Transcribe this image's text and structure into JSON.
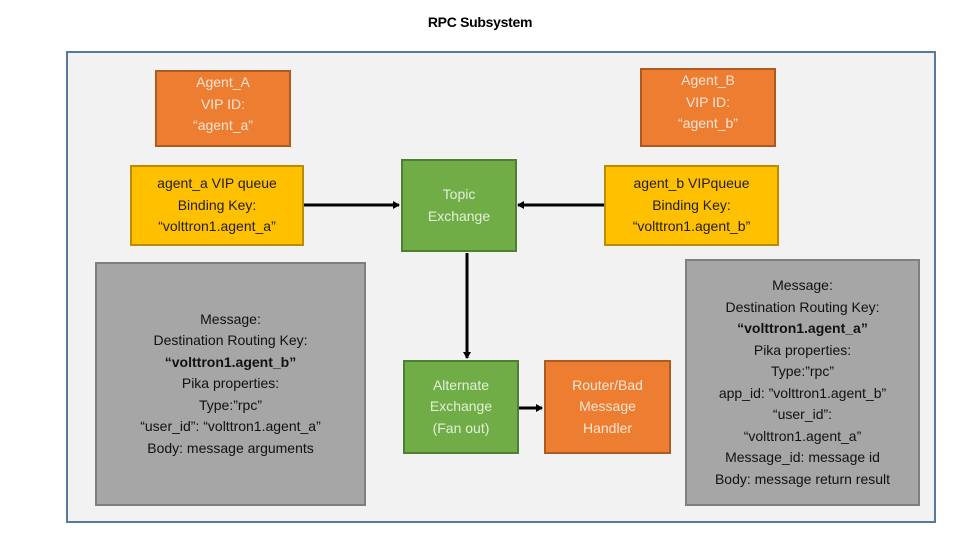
{
  "title": "RPC Subsystem",
  "nodes": {
    "agent_a": {
      "lines": [
        "Agent_A",
        "VIP ID:",
        "“agent_a”"
      ]
    },
    "agent_b": {
      "lines": [
        "Agent_B",
        "VIP ID:",
        "“agent_b”"
      ]
    },
    "agent_a_queue": {
      "lines": [
        "agent_a VIP queue",
        "Binding Key:",
        "“volttron1.agent_a”"
      ]
    },
    "agent_b_queue": {
      "lines": [
        "agent_b VIPqueue",
        "Binding Key:",
        "“volttron1.agent_b”"
      ]
    },
    "topic_exchange": {
      "lines": [
        "Topic",
        "Exchange"
      ]
    },
    "alternate_exchange": {
      "lines": [
        "Alternate",
        "Exchange",
        "(Fan out)"
      ]
    },
    "router_handler": {
      "lines": [
        "Router/Bad",
        "Message",
        "Handler"
      ]
    },
    "request_message": {
      "lines": [
        "Message:",
        "Destination Routing Key:",
        "“volttron1.agent_b”",
        "Pika properties:",
        "Type:”rpc”",
        "“user_id”: “volttron1.agent_a”",
        "Body: message arguments"
      ]
    },
    "response_message": {
      "lines": [
        "Message:",
        "Destination Routing Key:",
        "“volttron1.agent_a”",
        "Pika properties:",
        "Type:”rpc”",
        "app_id: ”volttron1.agent_b”",
        "“user_id”:",
        "“volttron1.agent_a”",
        "Message_id: message id",
        "Body: message return result"
      ]
    }
  },
  "edges": [
    {
      "from": "agent_a_queue",
      "to": "topic_exchange"
    },
    {
      "from": "agent_b_queue",
      "to": "topic_exchange"
    },
    {
      "from": "topic_exchange",
      "to": "alternate_exchange"
    },
    {
      "from": "alternate_exchange",
      "to": "router_handler"
    }
  ],
  "colors": {
    "agent": "#ed7d31",
    "queue": "#ffc000",
    "exchange": "#70ad47",
    "message": "#a6a6a6",
    "frame_border": "#577a9c"
  }
}
